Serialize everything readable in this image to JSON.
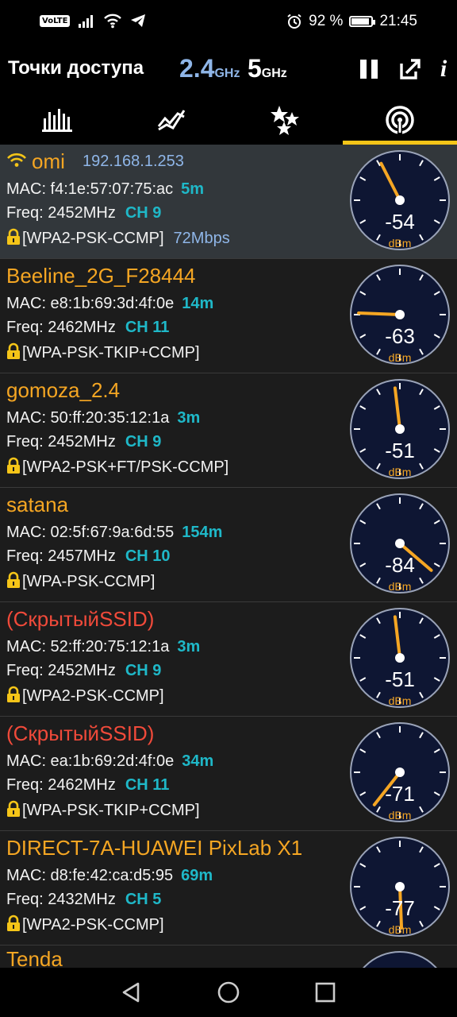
{
  "status": {
    "volte": "VoLTE",
    "battery": "92 %",
    "time": "21:45"
  },
  "app": {
    "title": "Точки доступа",
    "band_24": "2.4",
    "band_24_unit": "GHz",
    "band_5": "5",
    "band_5_unit": "GHz",
    "info_label": "i"
  },
  "tabs": [
    "channel-graph-icon",
    "time-graph-icon",
    "channel-rating-icon",
    "access-points-icon"
  ],
  "networks": [
    {
      "ssid": "omi",
      "ip": "192.168.1.253",
      "mac": "MAC: f4:1e:57:07:75:ac",
      "distance": "5m",
      "freq": "Freq: 2452MHz",
      "channel": "CH 9",
      "security": "[WPA2-PSK-CCMP]",
      "rate": "72Mbps",
      "signal": "-54",
      "unit": "dBm",
      "connected": true,
      "hidden": false
    },
    {
      "ssid": "Beeline_2G_F28444",
      "ip": "",
      "mac": "MAC: e8:1b:69:3d:4f:0e",
      "distance": "14m",
      "freq": "Freq: 2462MHz",
      "channel": "CH 11",
      "security": "[WPA-PSK-TKIP+CCMP]",
      "rate": "",
      "signal": "-63",
      "unit": "dBm",
      "connected": false,
      "hidden": false
    },
    {
      "ssid": "gomoza_2.4",
      "ip": "",
      "mac": "MAC: 50:ff:20:35:12:1a",
      "distance": "3m",
      "freq": "Freq: 2452MHz",
      "channel": "CH 9",
      "security": "[WPA2-PSK+FT/PSK-CCMP]",
      "rate": "",
      "signal": "-51",
      "unit": "dBm",
      "connected": false,
      "hidden": false
    },
    {
      "ssid": "satana",
      "ip": "",
      "mac": "MAC: 02:5f:67:9a:6d:55",
      "distance": "154m",
      "freq": "Freq: 2457MHz",
      "channel": "CH 10",
      "security": "[WPA-PSK-CCMP]",
      "rate": "",
      "signal": "-84",
      "unit": "dBm",
      "connected": false,
      "hidden": false
    },
    {
      "ssid": "(СкрытыйSSID)",
      "ip": "",
      "mac": "MAC: 52:ff:20:75:12:1a",
      "distance": "3m",
      "freq": "Freq: 2452MHz",
      "channel": "CH 9",
      "security": "[WPA2-PSK-CCMP]",
      "rate": "",
      "signal": "-51",
      "unit": "dBm",
      "connected": false,
      "hidden": true
    },
    {
      "ssid": "(СкрытыйSSID)",
      "ip": "",
      "mac": "MAC: ea:1b:69:2d:4f:0e",
      "distance": "34m",
      "freq": "Freq: 2462MHz",
      "channel": "CH 11",
      "security": "[WPA-PSK-TKIP+CCMP]",
      "rate": "",
      "signal": "-71",
      "unit": "dBm",
      "connected": false,
      "hidden": true
    },
    {
      "ssid": "DIRECT-7A-HUAWEI PixLab X1",
      "ip": "",
      "mac": "MAC: d8:fe:42:ca:d5:95",
      "distance": "69m",
      "freq": "Freq: 2432MHz",
      "channel": "CH 5",
      "security": "[WPA2-PSK-CCMP]",
      "rate": "",
      "signal": "-77",
      "unit": "dBm",
      "connected": false,
      "hidden": false
    }
  ],
  "partial_network": {
    "ssid": "Tenda"
  },
  "colors": {
    "accent": "#f5c518",
    "ssid": "#f5a623",
    "hidden_ssid": "#f04a3a",
    "cyan": "#1fb8c8",
    "blue": "#8fb6e8",
    "gauge_face": "#0e1633"
  }
}
